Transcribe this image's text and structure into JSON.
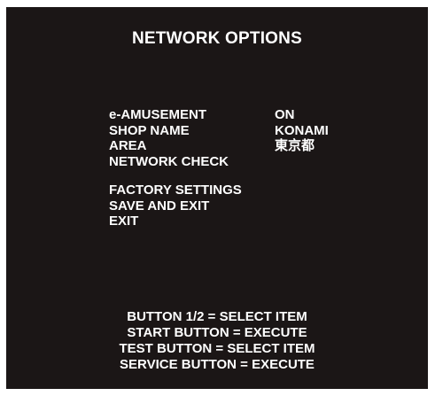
{
  "screen": {
    "title": "NETWORK OPTIONS",
    "colors": {
      "background": "#1b1616",
      "text": "#ffffff",
      "border": "#ffffff"
    }
  },
  "menu": {
    "group1": [
      {
        "label": "e-AMUSEMENT",
        "value": "ON"
      },
      {
        "label": "SHOP NAME",
        "value": "KONAMI"
      },
      {
        "label": "AREA",
        "value": "東京都"
      },
      {
        "label": "NETWORK CHECK",
        "value": ""
      }
    ],
    "group2": [
      {
        "label": "FACTORY SETTINGS"
      },
      {
        "label": "SAVE AND EXIT"
      },
      {
        "label": "EXIT"
      }
    ]
  },
  "instructions": [
    "BUTTON 1/2 = SELECT ITEM",
    "START BUTTON = EXECUTE",
    "TEST BUTTON = SELECT ITEM",
    "SERVICE BUTTON = EXECUTE"
  ]
}
